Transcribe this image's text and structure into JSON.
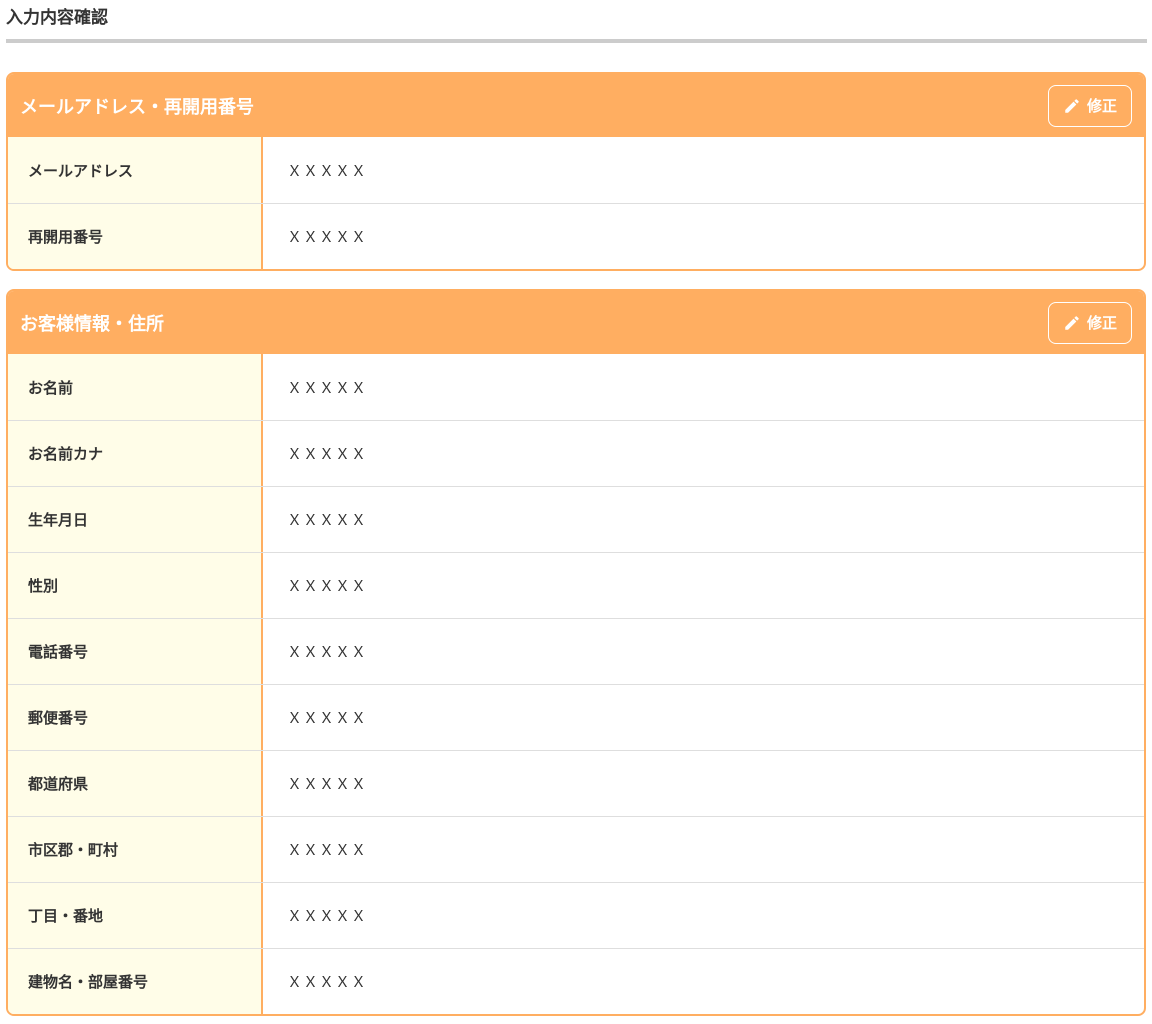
{
  "page": {
    "title": "入力内容確認"
  },
  "colors": {
    "accent": "#ffae61",
    "label_bg": "#fffde8",
    "divider": "#cccccc"
  },
  "icons": {
    "edit": "pencil-icon"
  },
  "sections": [
    {
      "title": "メールアドレス・再開用番号",
      "edit_label": "修正",
      "rows": [
        {
          "label": "メールアドレス",
          "value": "ＸＸＸＸＸ"
        },
        {
          "label": "再開用番号",
          "value": "ＸＸＸＸＸ"
        }
      ]
    },
    {
      "title": "お客様情報・住所",
      "edit_label": "修正",
      "rows": [
        {
          "label": "お名前",
          "value": "ＸＸＸＸＸ"
        },
        {
          "label": "お名前カナ",
          "value": "ＸＸＸＸＸ"
        },
        {
          "label": "生年月日",
          "value": "ＸＸＸＸＸ"
        },
        {
          "label": "性別",
          "value": "ＸＸＸＸＸ"
        },
        {
          "label": "電話番号",
          "value": "ＸＸＸＸＸ"
        },
        {
          "label": "郵便番号",
          "value": "ＸＸＸＸＸ"
        },
        {
          "label": "都道府県",
          "value": "ＸＸＸＸＸ"
        },
        {
          "label": "市区郡・町村",
          "value": "ＸＸＸＸＸ"
        },
        {
          "label": "丁目・番地",
          "value": "ＸＸＸＸＸ"
        },
        {
          "label": "建物名・部屋番号",
          "value": "ＸＸＸＸＸ"
        }
      ]
    }
  ]
}
